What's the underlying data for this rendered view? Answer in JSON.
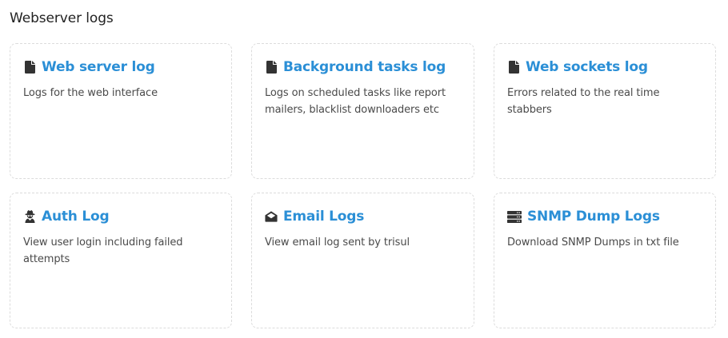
{
  "page": {
    "title": "Webserver logs"
  },
  "colors": {
    "accent": "#2b8fd6",
    "icon": "#333333",
    "border": "#dcdcdc"
  },
  "cards": [
    {
      "title": "Web server log",
      "description": "Logs for the web interface",
      "icon": "file-icon"
    },
    {
      "title": "Background tasks log",
      "description": "Logs on scheduled tasks like report mailers, blacklist downloaders etc",
      "icon": "file-icon"
    },
    {
      "title": "Web sockets log",
      "description": "Errors related to the real time stabbers",
      "icon": "file-icon"
    },
    {
      "title": "Auth Log",
      "description": "View user login including failed attempts",
      "icon": "user-secret-icon"
    },
    {
      "title": "Email Logs",
      "description": "View email log sent by trisul",
      "icon": "envelope-open-icon"
    },
    {
      "title": "SNMP Dump Logs",
      "description": "Download SNMP Dumps in txt file",
      "icon": "server-icon"
    }
  ]
}
